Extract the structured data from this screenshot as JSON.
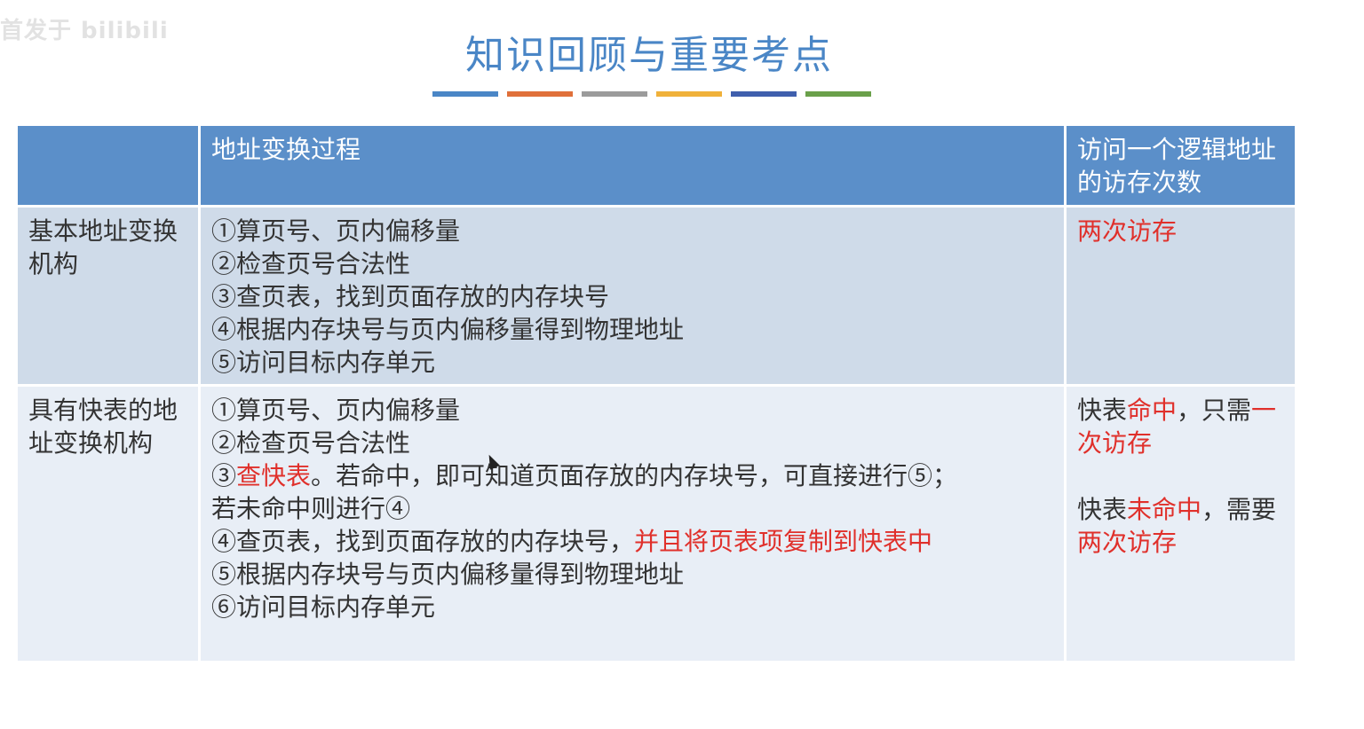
{
  "watermark": "首发于 bilibili",
  "title": "知识回顾与重要考点",
  "accent_colors": [
    "#4a86c6",
    "#e0703a",
    "#9b9b9b",
    "#f0b13a",
    "#3f5fad",
    "#6aa04a"
  ],
  "table": {
    "header": {
      "col1": "",
      "col2": "地址变换过程",
      "col3": "访问一个逻辑地址的访存次数"
    },
    "rows": [
      {
        "name": "基本地址变换机构",
        "steps": [
          "①算页号、页内偏移量",
          "②检查页号合法性",
          "③查页表，找到页面存放的内存块号",
          "④根据内存块号与页内偏移量得到物理地址",
          "⑤访问目标内存单元"
        ],
        "access": "两次访存"
      },
      {
        "name": "具有快表的地址变换机构",
        "steps": {
          "s1": "①算页号、页内偏移量",
          "s2": "②检查页号合法性",
          "s3_prefix": "③",
          "s3_red": "查快表",
          "s3_rest": "。若命中，即可知道页面存放的内存块号，可直接进行⑤；",
          "s3_line2": "若未命中则进行④",
          "s4_normal": "④查页表，找到页面存放的内存块号，",
          "s4_red": "并且将页表项复制到快表中",
          "s5": "⑤根据内存块号与页内偏移量得到物理地址",
          "s6": "⑥访问目标内存单元"
        },
        "access": {
          "hit_prefix": "快表",
          "hit_red": "命中",
          "hit_mid": "，只需",
          "hit_red2": "一次访存",
          "miss_prefix": "快表",
          "miss_red": "未命中",
          "miss_mid": "，需要",
          "miss_red2": "两次访存"
        }
      }
    ]
  }
}
